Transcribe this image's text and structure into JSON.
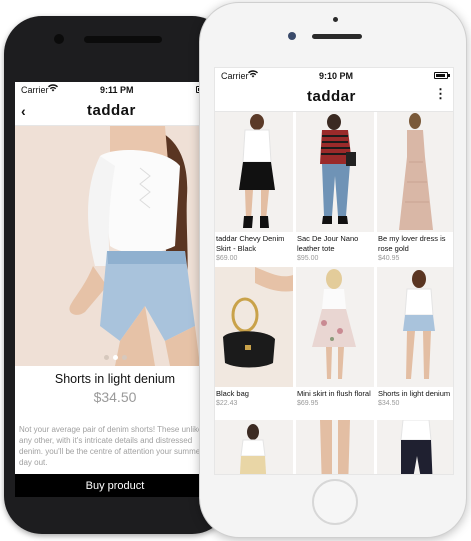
{
  "detail_screen": {
    "status": {
      "carrier": "Carrier",
      "time": "9:11 PM"
    },
    "nav": {
      "logo": "taddar",
      "back_icon": "back-chevron-icon"
    },
    "product": {
      "name": "Shorts in light denium",
      "price": "$34.50",
      "description": "Not your average pair of denim shorts! These unlike any other, with it's intricate details and distressed denim. you'll be the centre of attention your summer day out."
    },
    "carousel": {
      "count": 3,
      "active_index": 1
    },
    "buy_label": "Buy product"
  },
  "list_screen": {
    "status": {
      "carrier": "Carrier",
      "time": "9:10 PM"
    },
    "nav": {
      "logo": "taddar",
      "menu_icon": "more-vertical-icon"
    },
    "products": [
      {
        "name": "",
        "price": ""
      },
      {
        "name": "taddar Chevy Denim Skirt - Black",
        "price": "$69.00"
      },
      {
        "name": "Sac De Jour Nano leather tote",
        "price": "$95.00"
      },
      {
        "name": "Be my lover dress is rose gold",
        "price": "$40.95"
      },
      {
        "name": "Black bag",
        "price": "$22.43"
      },
      {
        "name": "Mini skirt in flush floral",
        "price": "$69.95"
      },
      {
        "name": "Shorts in light denium",
        "price": "$34.50"
      }
    ]
  },
  "colors": {
    "dark_phone": "#1d1d1f",
    "button_bg": "#000000",
    "price_gray": "#9a9a9a"
  }
}
